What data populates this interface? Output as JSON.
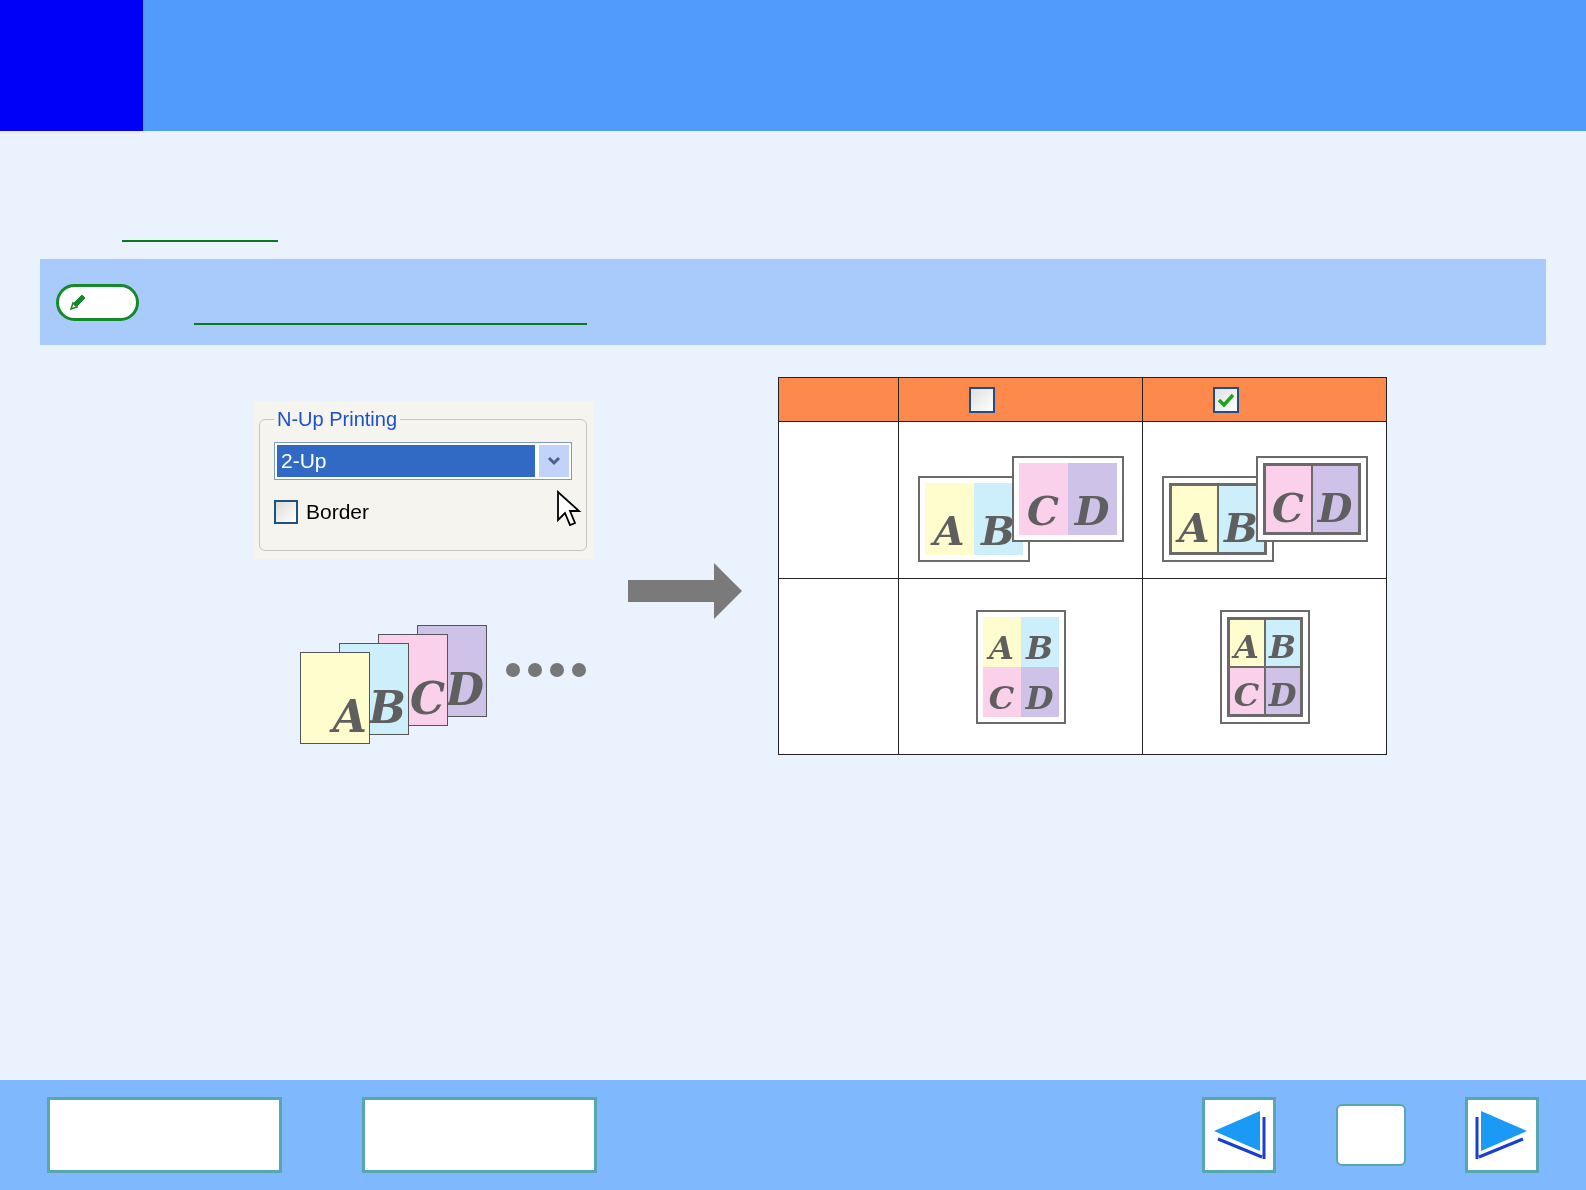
{
  "dialog": {
    "group_label": "N-Up Printing",
    "dropdown": {
      "value": "2-Up"
    },
    "checkbox": {
      "label": "Border",
      "checked": false
    }
  },
  "page_stack": {
    "pages": [
      {
        "letter": "A",
        "color": "#fffcce"
      },
      {
        "letter": "B",
        "color": "#cdeefb"
      },
      {
        "letter": "C",
        "color": "#fbd0ea"
      },
      {
        "letter": "D",
        "color": "#cfc2e8"
      }
    ]
  },
  "table": {
    "columns": [
      {
        "kind": "blank"
      },
      {
        "kind": "checkbox",
        "checked": false
      },
      {
        "kind": "checkbox",
        "checked": true
      }
    ],
    "rows": [
      {
        "cells": [
          {
            "kind": "blank"
          },
          {
            "kind": "two_up",
            "border": false,
            "sheets": [
              {
                "pages": [
                  {
                    "letter": "A",
                    "color": "#fffcce"
                  },
                  {
                    "letter": "B",
                    "color": "#cdeefb"
                  }
                ]
              },
              {
                "pages": [
                  {
                    "letter": "C",
                    "color": "#fbd0ea"
                  },
                  {
                    "letter": "D",
                    "color": "#cfc2e8"
                  }
                ]
              }
            ]
          },
          {
            "kind": "two_up",
            "border": true,
            "sheets": [
              {
                "pages": [
                  {
                    "letter": "A",
                    "color": "#fffcce"
                  },
                  {
                    "letter": "B",
                    "color": "#cdeefb"
                  }
                ]
              },
              {
                "pages": [
                  {
                    "letter": "C",
                    "color": "#fbd0ea"
                  },
                  {
                    "letter": "D",
                    "color": "#cfc2e8"
                  }
                ]
              }
            ]
          }
        ]
      },
      {
        "cells": [
          {
            "kind": "blank"
          },
          {
            "kind": "four_up",
            "border": false,
            "sheets": [
              {
                "pages": [
                  {
                    "letter": "A",
                    "color": "#fffcce"
                  },
                  {
                    "letter": "B",
                    "color": "#cdeefb"
                  },
                  {
                    "letter": "C",
                    "color": "#fbd0ea"
                  },
                  {
                    "letter": "D",
                    "color": "#cfc2e8"
                  }
                ]
              }
            ]
          },
          {
            "kind": "four_up",
            "border": true,
            "sheets": [
              {
                "pages": [
                  {
                    "letter": "A",
                    "color": "#fffcce"
                  },
                  {
                    "letter": "B",
                    "color": "#cdeefb"
                  },
                  {
                    "letter": "C",
                    "color": "#fbd0ea"
                  },
                  {
                    "letter": "D",
                    "color": "#cfc2e8"
                  }
                ]
              }
            ]
          }
        ]
      }
    ]
  }
}
